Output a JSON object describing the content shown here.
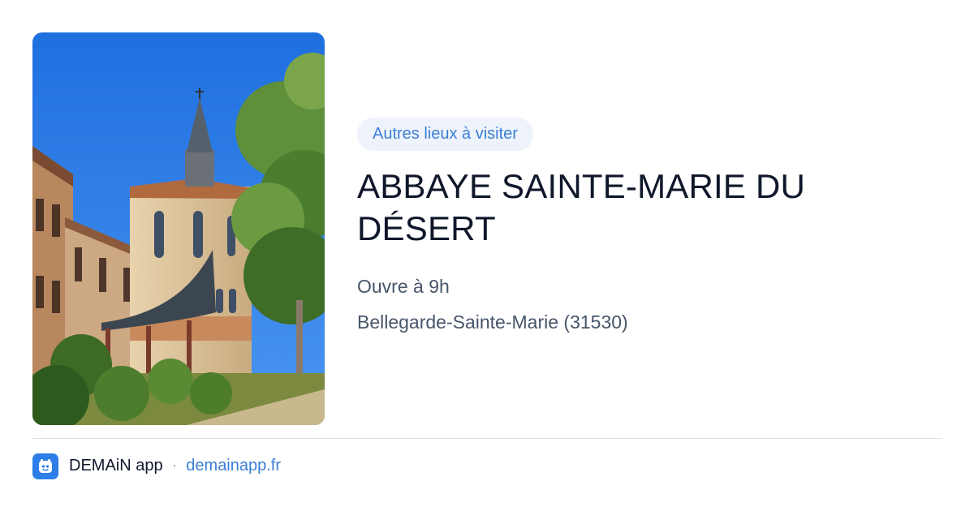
{
  "card": {
    "photo_alt": "Abbaye Sainte-Marie du Désert",
    "category_chip": "Autres lieux à visiter",
    "title": "ABBAYE SAINTE-MARIE DU DÉSERT",
    "hours": "Ouvre à 9h",
    "location": "Bellegarde-Sainte-Marie (31530)"
  },
  "footer": {
    "app_icon": "app-logo-icon",
    "app_name": "DEMAiN app",
    "separator": "·",
    "link": "demainapp.fr"
  },
  "colors": {
    "accent": "#3b7fd6",
    "chip_bg": "#eef3fb",
    "title": "#0f172a",
    "meta": "#475569",
    "app_icon_bg": "#2d7ee6"
  }
}
